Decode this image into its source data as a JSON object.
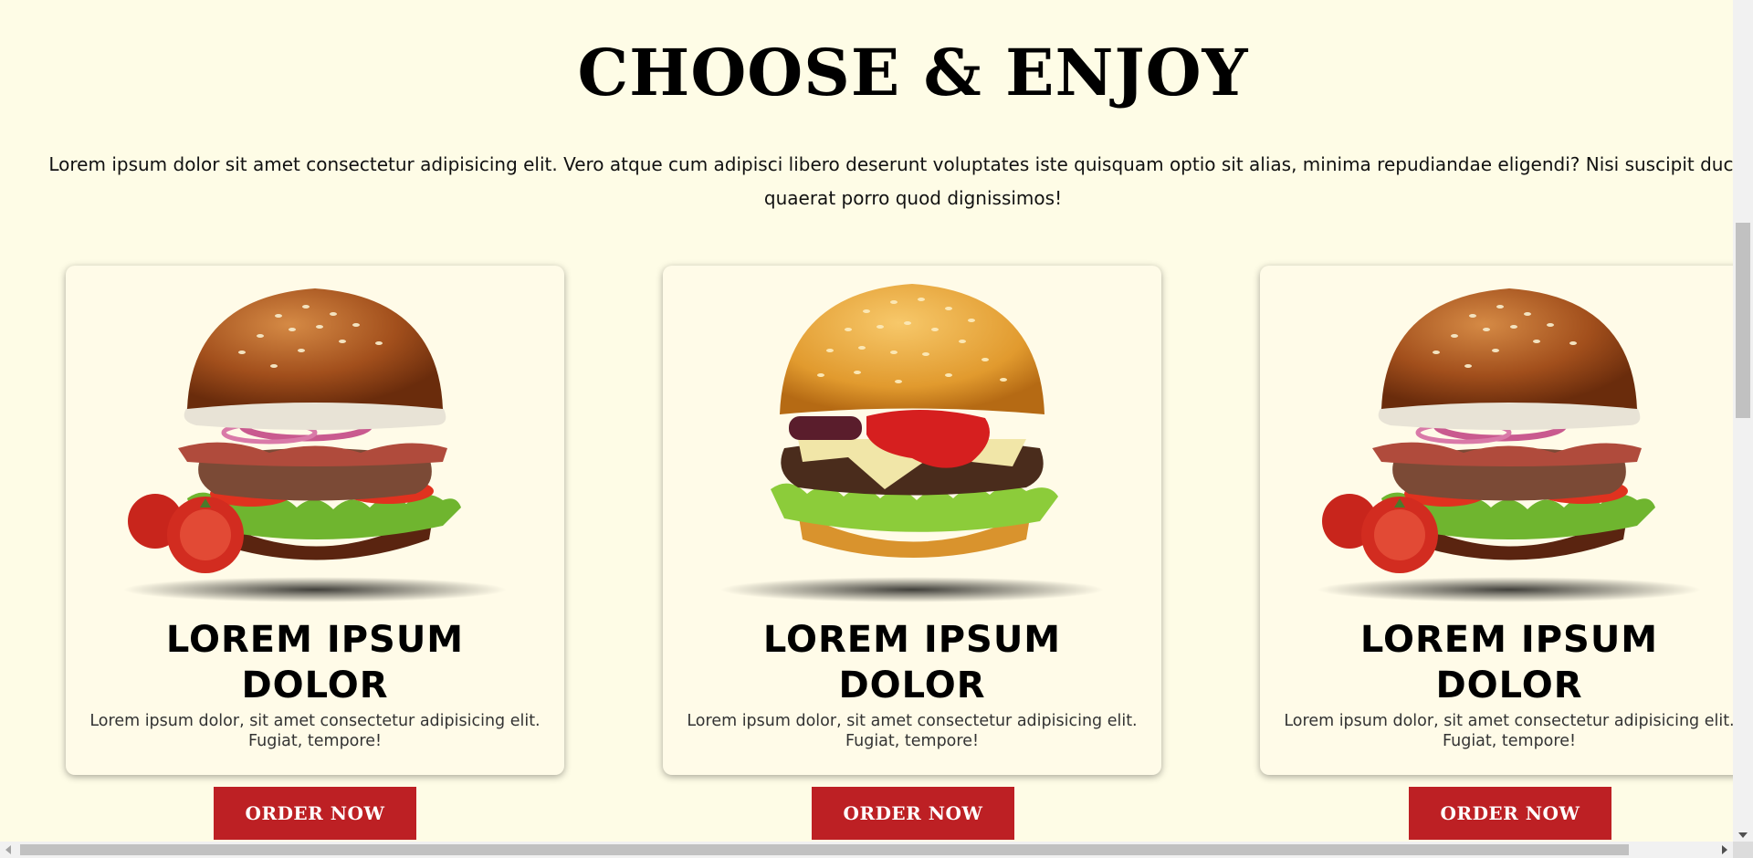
{
  "section": {
    "title": "CHOOSE & ENJOY",
    "intro": "Lorem ipsum dolor sit amet consectetur adipisicing elit. Vero atque cum adipisci libero deserunt voluptates iste quisquam optio sit alias, minima repudiandae eligendi? Nisi suscipit ducimus quaerat porro quod dignissimos!"
  },
  "cards": [
    {
      "title_line1": "LOREM IPSUM",
      "title_line2": "DOLOR",
      "text": "Lorem ipsum dolor, sit amet consectetur adipisicing elit. Fugiat, tempore!",
      "button": "ORDER NOW",
      "image": "bacon-burger-with-tomatoes"
    },
    {
      "title_line1": "LOREM IPSUM",
      "title_line2": "DOLOR",
      "text": "Lorem ipsum dolor, sit amet consectetur adipisicing elit. Fugiat, tempore!",
      "button": "ORDER NOW",
      "image": "cheeseburger-with-ketchup"
    },
    {
      "title_line1": "LOREM IPSUM",
      "title_line2": "DOLOR",
      "text": "Lorem ipsum dolor, sit amet consectetur adipisicing elit. Fugiat, tempore!",
      "button": "ORDER NOW",
      "image": "bacon-burger-with-tomatoes"
    }
  ],
  "colors": {
    "background": "#fefce6",
    "card": "#fffbe8",
    "accent": "#bd2024"
  }
}
